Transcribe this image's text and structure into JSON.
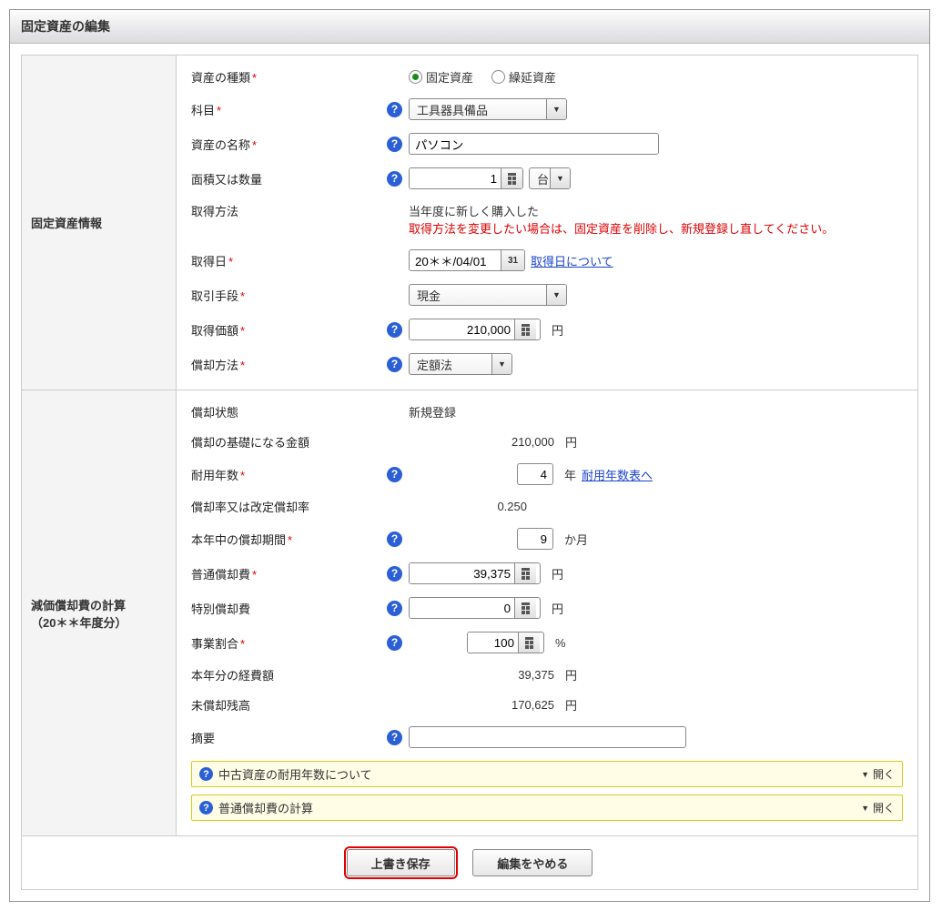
{
  "title": "固定資産の編集",
  "section1": {
    "heading": "固定資産情報",
    "fields": {
      "asset_type": {
        "label": "資産の種類",
        "opt1": "固定資産",
        "opt2": "繰延資産"
      },
      "account": {
        "label": "科目",
        "value": "工具器具備品"
      },
      "asset_name": {
        "label": "資産の名称",
        "value": "パソコン"
      },
      "qty": {
        "label": "面積又は数量",
        "value": "1",
        "unit": "台"
      },
      "acq_method": {
        "label": "取得方法",
        "line1": "当年度に新しく購入した",
        "line2": "取得方法を変更したい場合は、固定資産を削除し、新規登録し直してください。"
      },
      "acq_date": {
        "label": "取得日",
        "value": "20＊＊/04/01",
        "btn": "31",
        "link": "取得日について"
      },
      "pay_method": {
        "label": "取引手段",
        "value": "現金"
      },
      "acq_cost": {
        "label": "取得価額",
        "value": "210,000",
        "unit": "円"
      },
      "dep_method": {
        "label": "償却方法",
        "value": "定額法"
      }
    }
  },
  "section2": {
    "heading_l1": "減価償却費の計算",
    "heading_l2": "（20＊＊年度分）",
    "fields": {
      "status": {
        "label": "償却状態",
        "value": "新規登録"
      },
      "base": {
        "label": "償却の基礎になる金額",
        "value": "210,000",
        "unit": "円"
      },
      "life": {
        "label": "耐用年数",
        "value": "4",
        "unit": "年",
        "link": "耐用年数表へ"
      },
      "rate": {
        "label": "償却率又は改定償却率",
        "value": "0.250"
      },
      "period": {
        "label": "本年中の償却期間",
        "value": "9",
        "unit": "か月"
      },
      "ord_dep": {
        "label": "普通償却費",
        "value": "39,375",
        "unit": "円"
      },
      "spec_dep": {
        "label": "特別償却費",
        "value": "0",
        "unit": "円"
      },
      "biz_ratio": {
        "label": "事業割合",
        "value": "100",
        "unit": "%"
      },
      "expense": {
        "label": "本年分の経費額",
        "value": "39,375",
        "unit": "円"
      },
      "residual": {
        "label": "未償却残高",
        "value": "170,625",
        "unit": "円"
      },
      "summary": {
        "label": "摘要",
        "value": ""
      }
    },
    "info1": "中古資産の耐用年数について",
    "info2": "普通償却費の計算",
    "open": "開く"
  },
  "buttons": {
    "save": "上書き保存",
    "cancel": "編集をやめる"
  }
}
